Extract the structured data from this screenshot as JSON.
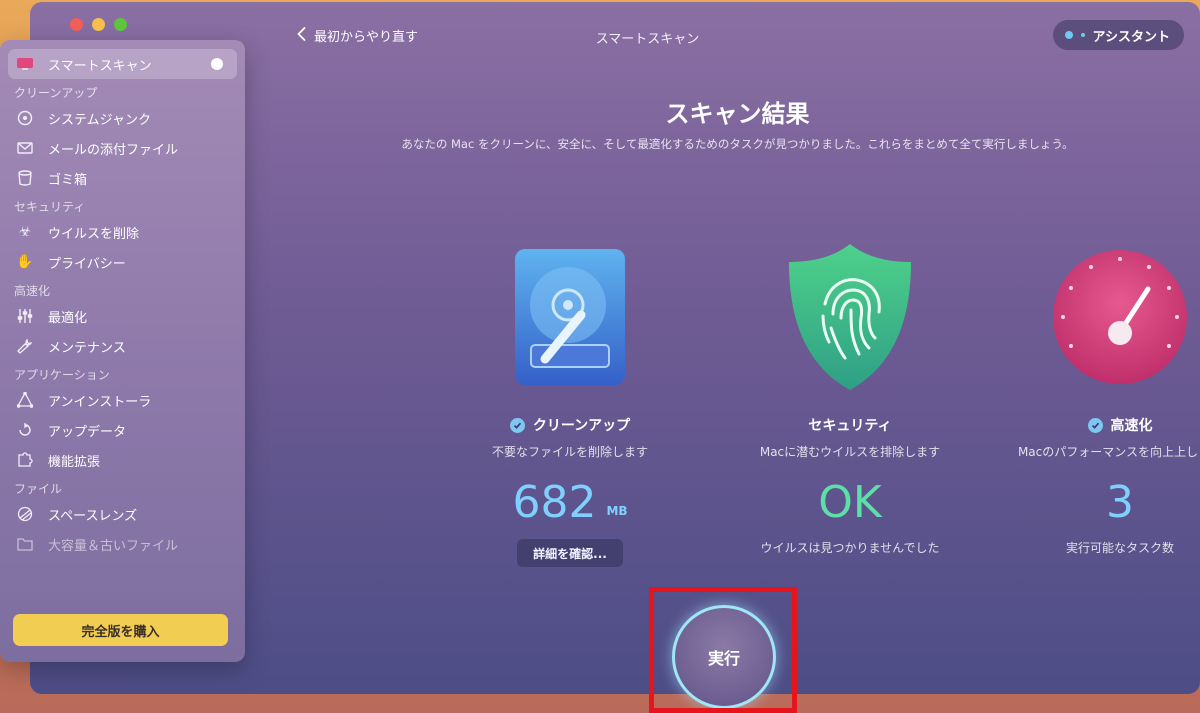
{
  "window": {
    "title": "スマートスキャン"
  },
  "topbar": {
    "back_label": "最初からやり直す",
    "assistant_label": "アシスタント"
  },
  "sidebar": {
    "active_item": "スマートスキャン",
    "sections": [
      {
        "title": "クリーンアップ",
        "items": [
          "システムジャンク",
          "メールの添付ファイル",
          "ゴミ箱"
        ]
      },
      {
        "title": "セキュリティ",
        "items": [
          "ウイルスを削除",
          "プライバシー"
        ]
      },
      {
        "title": "高速化",
        "items": [
          "最適化",
          "メンテナンス"
        ]
      },
      {
        "title": "アプリケーション",
        "items": [
          "アンインストーラ",
          "アップデータ",
          "機能拡張"
        ]
      },
      {
        "title": "ファイル",
        "items": [
          "スペースレンズ",
          "大容量＆古いファイル"
        ]
      }
    ],
    "buy_label": "完全版を購入"
  },
  "main": {
    "title": "スキャン結果",
    "description": "あなたの Mac をクリーンに、安全に、そして最適化するためのタスクが見つかりました。これらをまとめて全て実行しましょう。",
    "cards": [
      {
        "name": "クリーンアップ",
        "desc": "不要なファイルを削除します",
        "value": "682",
        "unit": "MB",
        "button": "詳細を確認..."
      },
      {
        "name": "セキュリティ",
        "desc": "Macに潜むウイルスを排除します",
        "value": "OK",
        "sub": "ウイルスは見つかりませんでした"
      },
      {
        "name": "高速化",
        "desc": "Macのパフォーマンスを向上上します",
        "value": "3",
        "sub": "実行可能なタスク数"
      }
    ],
    "run_label": "実行"
  },
  "colors": {
    "accent_blue": "#7fd0ff",
    "ok_green": "#5de0a8",
    "buy_yellow": "#f1cd52",
    "highlight_red": "#e8141b"
  }
}
